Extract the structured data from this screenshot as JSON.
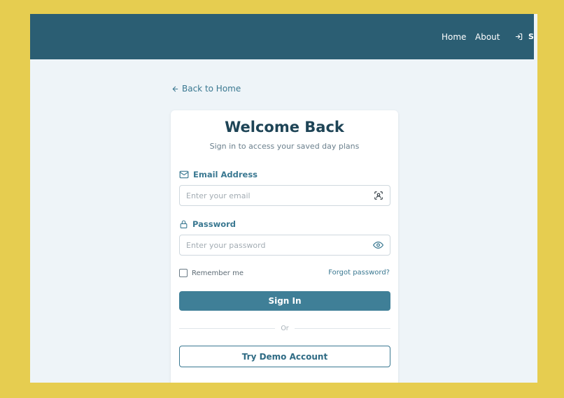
{
  "nav": {
    "home": "Home",
    "about": "About",
    "sign_in": "Si"
  },
  "back_link": "Back to Home",
  "login": {
    "title": "Welcome Back",
    "subtitle": "Sign in to access your saved day plans",
    "email_label": "Email Address",
    "email_placeholder": "Enter your email",
    "password_label": "Password",
    "password_placeholder": "Enter your password",
    "remember_me": "Remember me",
    "forgot_password": "Forgot password?",
    "sign_in_button": "Sign In",
    "divider": "Or",
    "demo_button": "Try Demo Account"
  },
  "icons": {
    "back": "arrow-left-icon",
    "sign_in": "log-in-icon",
    "email": "mail-icon",
    "email_autofill": "contact-scan-icon",
    "password": "lock-icon",
    "show_password": "eye-icon"
  },
  "colors": {
    "header": "#2b5e73",
    "primary": "#3f7f97",
    "accent_text": "#3a7891",
    "title": "#1e4456",
    "background": "#eef4f8"
  }
}
